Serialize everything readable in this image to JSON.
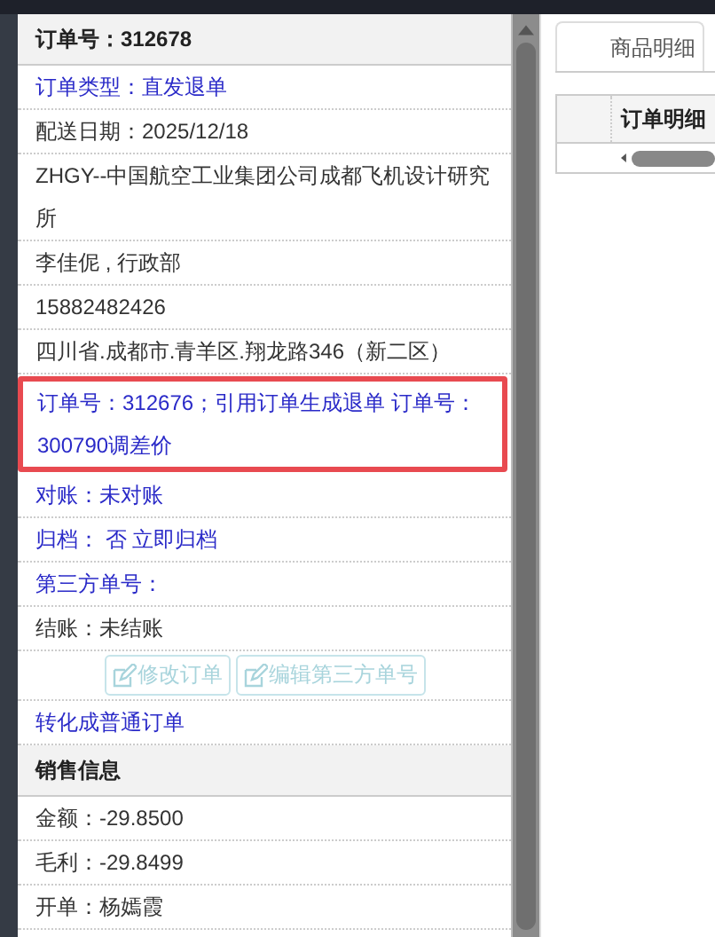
{
  "order_panel": {
    "rows": [
      {
        "kind": "header",
        "text": "订单号：312678"
      },
      {
        "kind": "link",
        "text": "订单类型：直发退单"
      },
      {
        "kind": "plain",
        "text": "配送日期：2025/12/18"
      },
      {
        "kind": "plain",
        "text": "ZHGY--中国航空工业集团公司成都飞机设计研究所"
      },
      {
        "kind": "plain",
        "text": "李佳伲 , 行政部"
      },
      {
        "kind": "plain",
        "text": "15882482426"
      },
      {
        "kind": "plain",
        "text": "四川省.成都市.青羊区.翔龙路346（新二区）"
      },
      {
        "kind": "flagged",
        "text": "订单号：312676；引用订单生成退单 订单号：300790调差价"
      },
      {
        "kind": "link",
        "text": "对账：未对账"
      },
      {
        "kind": "link",
        "text": "归档：  否 立即归档"
      },
      {
        "kind": "link",
        "text": "第三方单号："
      },
      {
        "kind": "plain",
        "text": "结账：未结账"
      },
      {
        "kind": "buttons",
        "buttons": [
          {
            "label": "修改订单",
            "disabled": true
          },
          {
            "label": "编辑第三方单号",
            "disabled": true
          }
        ]
      },
      {
        "kind": "link",
        "text": "转化成普通订单"
      },
      {
        "kind": "header",
        "text": "销售信息"
      },
      {
        "kind": "plain",
        "text": "金额：-29.8500"
      },
      {
        "kind": "plain",
        "text": "毛利：-29.8499"
      },
      {
        "kind": "plain",
        "text": "开单：杨嫣霞"
      }
    ]
  },
  "right_panel": {
    "tabs": [
      {
        "label": "商品明细",
        "selected": true
      }
    ],
    "table": {
      "columns": [
        "订单明细"
      ]
    }
  }
}
